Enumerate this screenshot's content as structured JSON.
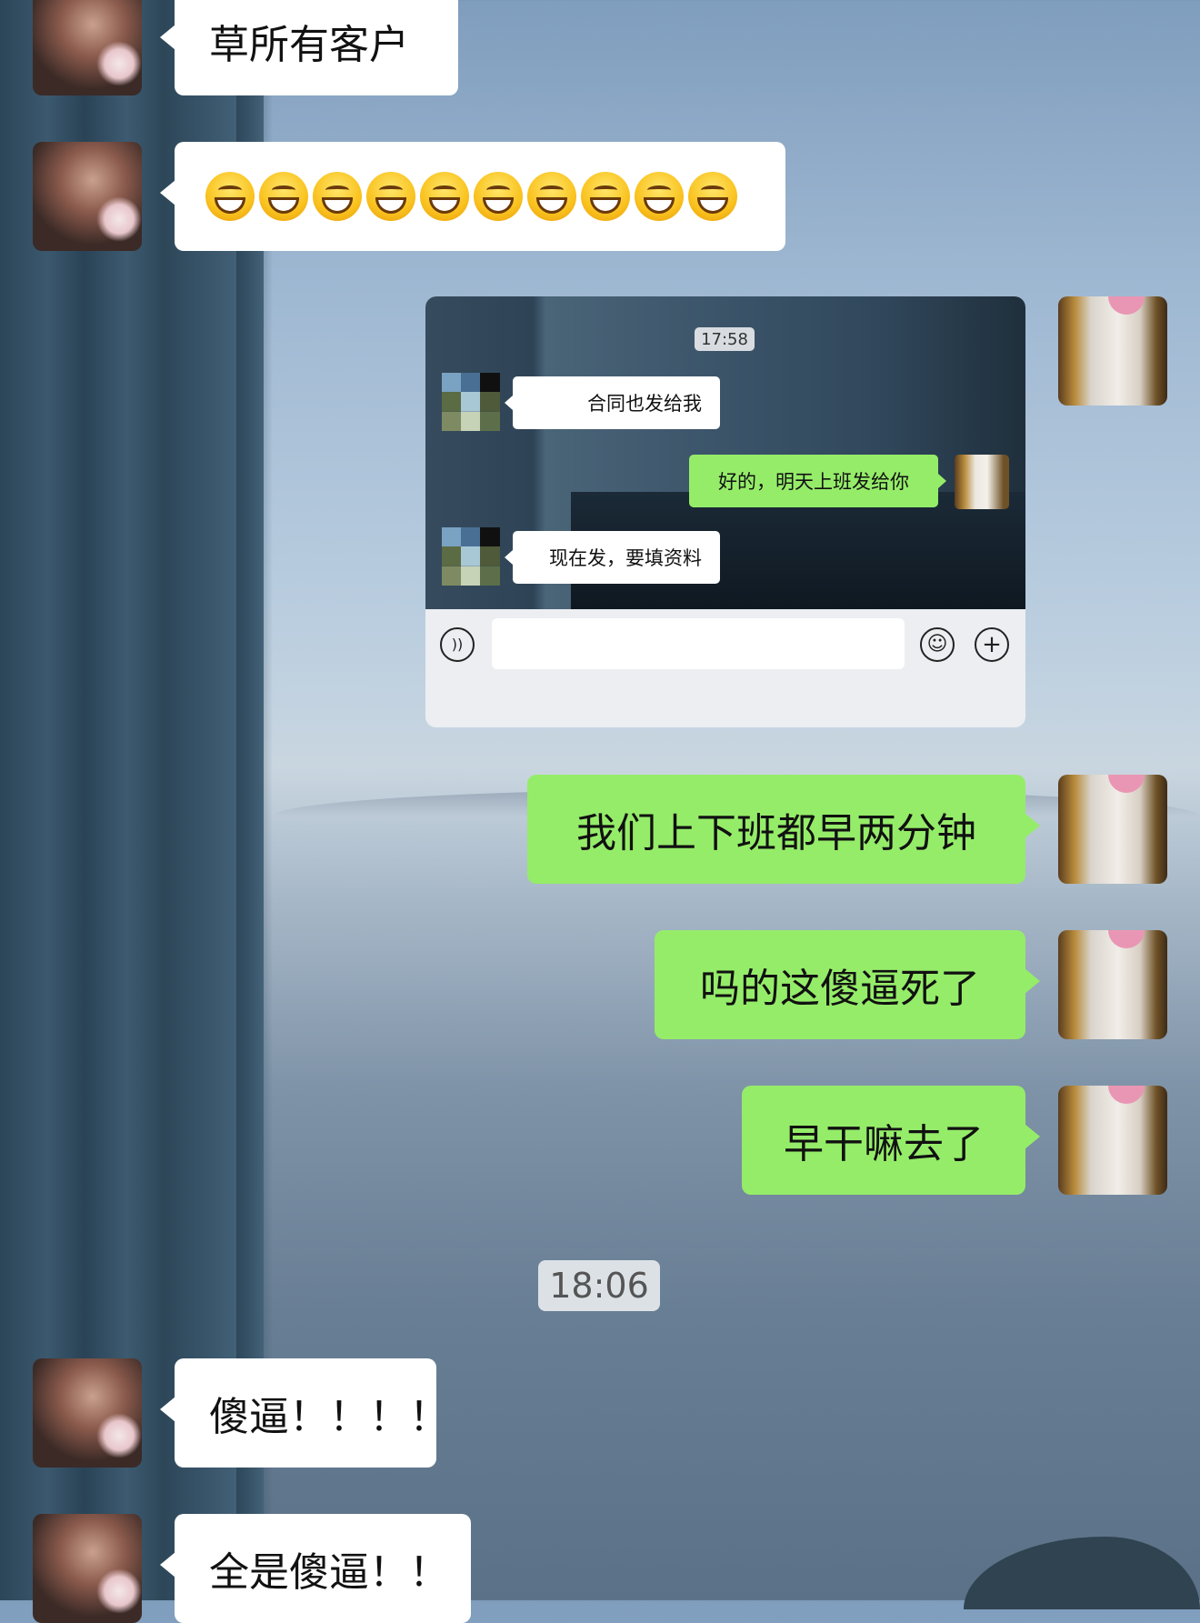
{
  "messages": {
    "m1": "草所有客户",
    "m3": "我们上下班都早两分钟",
    "m4": "吗的这傻逼死了",
    "m5": "早干嘛去了",
    "m6": "傻逼！！！！",
    "m7": "全是傻逼！！"
  },
  "emoji_row": {
    "emoji_name": "grinning-face-emoji",
    "count": 10
  },
  "screenshot": {
    "time": "17:58",
    "msg1": "合同也发给我",
    "msg2": "好的，明天上班发给你",
    "msg3": "现在发，要填资料",
    "voice_icon": "voice-icon",
    "emoji_icon": "smiley-icon",
    "plus_icon": "plus-icon"
  },
  "timestamp": "18:06",
  "colors": {
    "outgoing_bubble": "#95ec69",
    "incoming_bubble": "#ffffff"
  }
}
